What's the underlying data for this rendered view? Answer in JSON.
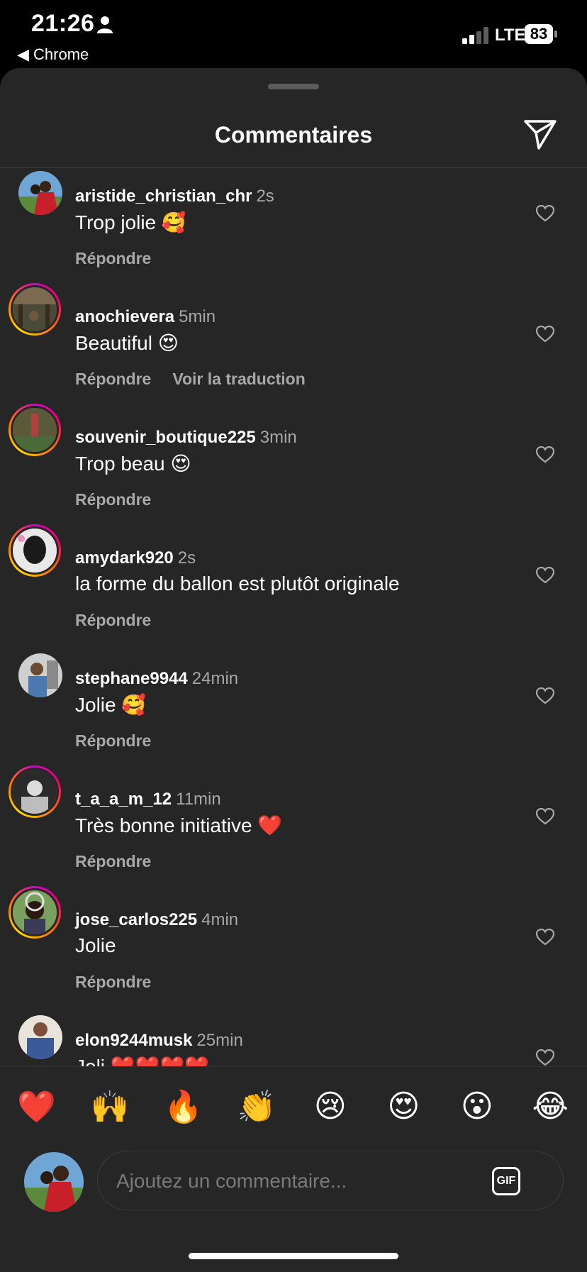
{
  "status": {
    "time": "21:26",
    "back_app": "◀ Chrome",
    "network": "LTE",
    "battery": "83"
  },
  "sheet": {
    "title": "Commentaires"
  },
  "comments": [
    {
      "username": "aristide_christian_chr",
      "time": "2s",
      "text": "Trop jolie 🥰",
      "reply": "Répondre",
      "translate": ""
    },
    {
      "username": "anochievera",
      "time": "5min",
      "text": "Beautiful 😍",
      "reply": "Répondre",
      "translate": "Voir la traduction"
    },
    {
      "username": "souvenir_boutique225",
      "time": "3min",
      "text": "Trop beau 😍",
      "reply": "Répondre",
      "translate": ""
    },
    {
      "username": "amydark920",
      "time": "2s",
      "text": "la forme du ballon est plutôt originale",
      "reply": "Répondre",
      "translate": ""
    },
    {
      "username": "stephane9944",
      "time": "24min",
      "text": "Jolie 🥰",
      "reply": "Répondre",
      "translate": ""
    },
    {
      "username": "t_a_a_m_12",
      "time": "11min",
      "text": "Très bonne initiative ❤️",
      "reply": "Répondre",
      "translate": ""
    },
    {
      "username": "jose_carlos225",
      "time": "4min",
      "text": "Jolie",
      "reply": "Répondre",
      "translate": ""
    },
    {
      "username": "elon9244musk",
      "time": "25min",
      "text": "Joli ❤️❤️❤️❤️",
      "reply": "",
      "translate": ""
    }
  ],
  "quick_emojis": [
    "❤️",
    "🙌",
    "🔥",
    "👏",
    "😢",
    "😍",
    "😮",
    "😂"
  ],
  "composer": {
    "placeholder": "Ajoutez un commentaire...",
    "gif_label": "GIF"
  },
  "colors": {
    "sheet_bg": "#262626",
    "muted_text": "#a8a8a8",
    "story_ring": "#d300c5"
  },
  "icons": {
    "send": "paper-plane-icon",
    "like": "heart-outline-icon",
    "gif": "gif-icon"
  }
}
